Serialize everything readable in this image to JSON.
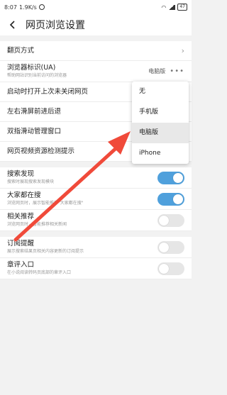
{
  "statusbar": {
    "time": "8:07",
    "speed": "1.9K/s",
    "battery": "47"
  },
  "header": {
    "title": "网页浏览设置"
  },
  "settings": [
    {
      "label": "翻页方式",
      "kind": "chevron"
    },
    {
      "label": "浏览器标识(UA)",
      "sub": "帮助网站识别当前访问的浏览器",
      "value": "电脑版",
      "kind": "more"
    },
    {
      "label": "启动时打开上次未关闭网页",
      "kind": "none"
    },
    {
      "label": "左右滑屏前进后退",
      "kind": "none"
    },
    {
      "label": "双指滑动管理窗口",
      "kind": "none"
    },
    {
      "label": "网页视频资源检测提示",
      "kind": "toggle",
      "on": true
    },
    {
      "label": "搜索发现",
      "sub": "搜索时展现搜索发现模块",
      "kind": "toggle",
      "on": true
    },
    {
      "label": "大家都在搜",
      "sub": "浏览网页时，展示智能推荐\"大家都在搜\"",
      "kind": "toggle",
      "on": true
    },
    {
      "label": "相关推荐",
      "sub": "浏览网页时，智能推荐相关新闻",
      "kind": "toggle",
      "on": false
    },
    {
      "label": "订阅提醒",
      "sub": "展示搜索结果页相关内容更新的订阅提示",
      "kind": "toggle",
      "on": false
    },
    {
      "label": "章评入口",
      "sub": "在小说阅读转码页底部的章评入口",
      "kind": "toggle",
      "on": false
    }
  ],
  "ua_menu": {
    "options": [
      "无",
      "手机版",
      "电脑版",
      "iPhone"
    ],
    "selected": "电脑版"
  },
  "colors": {
    "accent": "#4fa0dc",
    "arrow": "#f04a3a"
  }
}
